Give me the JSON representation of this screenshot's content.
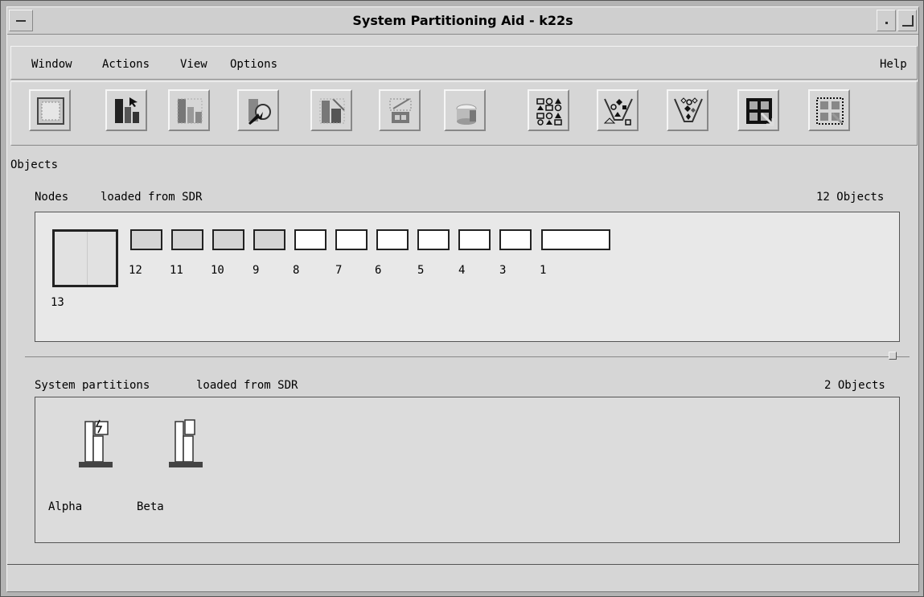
{
  "window": {
    "title": "System Partitioning Aid - k22s"
  },
  "menu": {
    "left": [
      "Window",
      "Actions",
      "View",
      "Options"
    ],
    "right": "Help"
  },
  "toolbar": {
    "tools": [
      "node-board-icon",
      "node-select-icon",
      "node-group-icon",
      "node-action-icon",
      "node-list-icon",
      "node-faded-icon",
      "cylinder-icon",
      "shapes-grid-icon",
      "shapes-bucket-icon",
      "shapes-bucket-filled-icon",
      "grid-expand-icon",
      "grid-dotted-icon"
    ]
  },
  "objects_label": "Objects",
  "nodes": {
    "title": "Nodes",
    "source": "loaded from SDR",
    "count": "12 Objects",
    "large": {
      "label": "13"
    },
    "items": [
      {
        "label": "12",
        "state": "assigned"
      },
      {
        "label": "11",
        "state": "assigned"
      },
      {
        "label": "10",
        "state": "assigned"
      },
      {
        "label": "9",
        "state": "assigned"
      },
      {
        "label": "8",
        "state": "free"
      },
      {
        "label": "7",
        "state": "free"
      },
      {
        "label": "6",
        "state": "free"
      },
      {
        "label": "5",
        "state": "free"
      },
      {
        "label": "4",
        "state": "free"
      },
      {
        "label": "3",
        "state": "free"
      },
      {
        "label": "1",
        "state": "free"
      }
    ]
  },
  "partitions": {
    "title": "System partitions",
    "source": "loaded from SDR",
    "count": "2 Objects",
    "items": [
      {
        "label": "Alpha",
        "icon": "partition-active-icon"
      },
      {
        "label": "Beta",
        "icon": "partition-icon"
      }
    ]
  },
  "colors": {
    "background": "#d6d6d6",
    "panel": "#e8e8e8",
    "assigned_node": "#d4d4d4",
    "free_node": "#ffffff"
  }
}
